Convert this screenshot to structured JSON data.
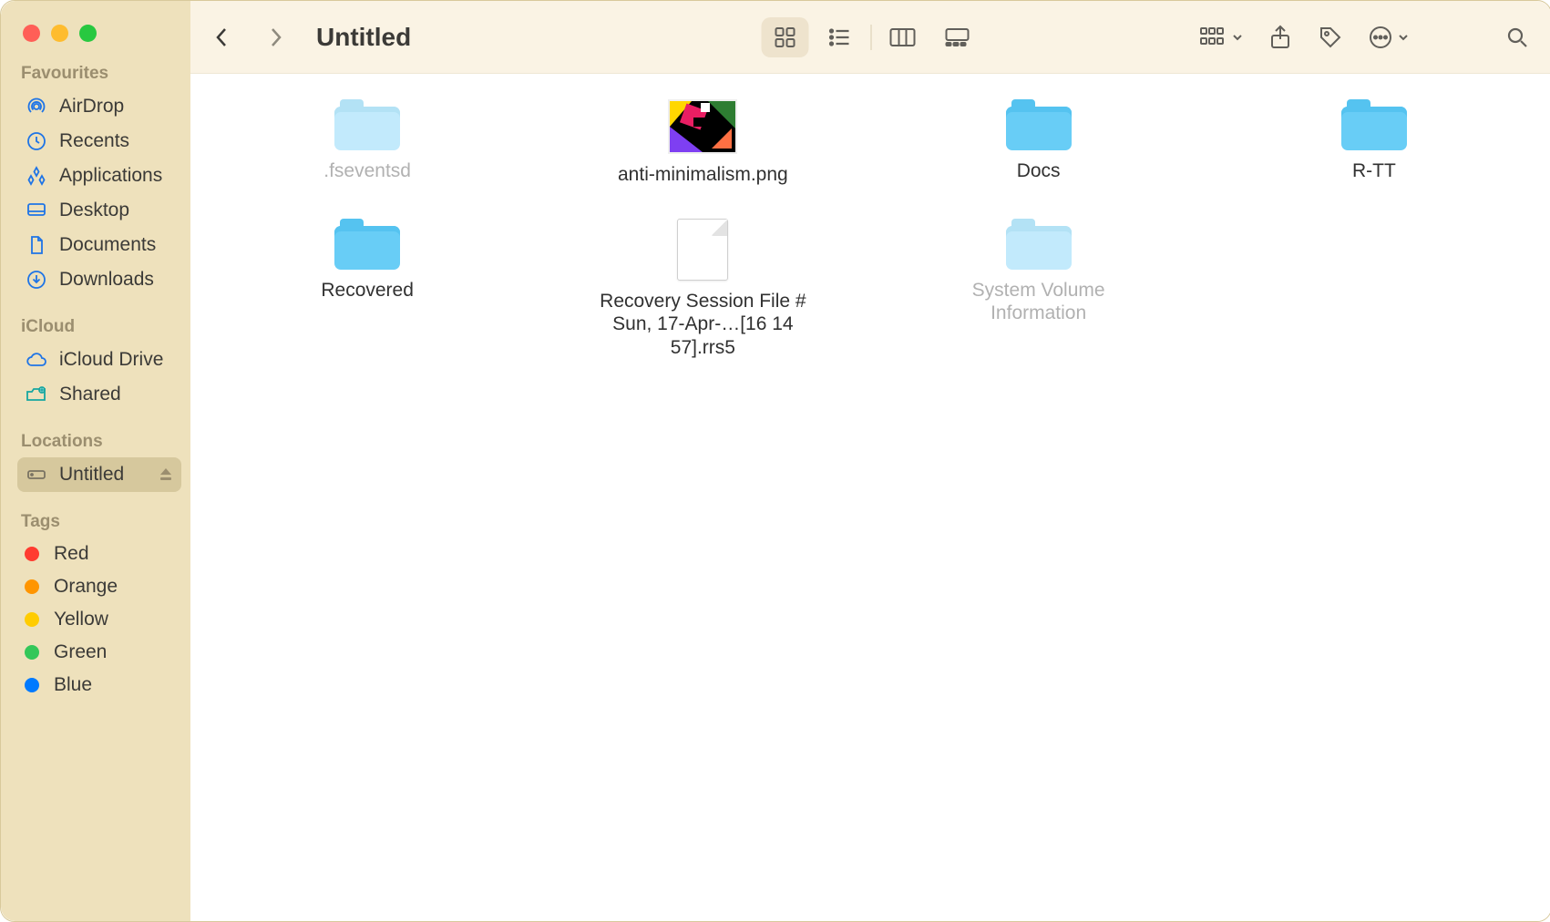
{
  "window": {
    "title": "Untitled"
  },
  "sidebar": {
    "sections": {
      "favourites": {
        "label": "Favourites",
        "items": [
          {
            "label": "AirDrop",
            "icon": "airdrop-icon"
          },
          {
            "label": "Recents",
            "icon": "clock-icon"
          },
          {
            "label": "Applications",
            "icon": "apps-icon"
          },
          {
            "label": "Desktop",
            "icon": "desktop-icon"
          },
          {
            "label": "Documents",
            "icon": "document-icon"
          },
          {
            "label": "Downloads",
            "icon": "downloads-icon"
          }
        ]
      },
      "icloud": {
        "label": "iCloud",
        "items": [
          {
            "label": "iCloud Drive",
            "icon": "cloud-icon"
          },
          {
            "label": "Shared",
            "icon": "shared-icon"
          }
        ]
      },
      "locations": {
        "label": "Locations",
        "items": [
          {
            "label": "Untitled",
            "icon": "drive-icon",
            "selected": true,
            "ejectable": true
          }
        ]
      },
      "tags": {
        "label": "Tags",
        "items": [
          {
            "label": "Red",
            "color": "red"
          },
          {
            "label": "Orange",
            "color": "orange"
          },
          {
            "label": "Yellow",
            "color": "yellow"
          },
          {
            "label": "Green",
            "color": "green"
          },
          {
            "label": "Blue",
            "color": "blue"
          }
        ]
      }
    }
  },
  "toolbar": {
    "back_enabled": true,
    "forward_enabled": false,
    "view_mode": "icon",
    "views": {
      "icon": "icon-view",
      "list": "list-view",
      "column": "column-view",
      "gallery": "gallery-view"
    }
  },
  "contents": {
    "items": [
      {
        "name": ".fseventsd",
        "type": "folder",
        "dim": true
      },
      {
        "name": "anti-minimalism.png",
        "type": "image",
        "dim": false
      },
      {
        "name": "Docs",
        "type": "folder",
        "dim": false
      },
      {
        "name": "R-TT",
        "type": "folder",
        "dim": false
      },
      {
        "name": "Recovered",
        "type": "folder",
        "dim": false
      },
      {
        "name": "Recovery Session File # Sun, 17-Apr-…[16 14 57].rrs5",
        "type": "file",
        "dim": false
      },
      {
        "name": "System Volume Information",
        "type": "folder",
        "dim": true
      }
    ]
  }
}
